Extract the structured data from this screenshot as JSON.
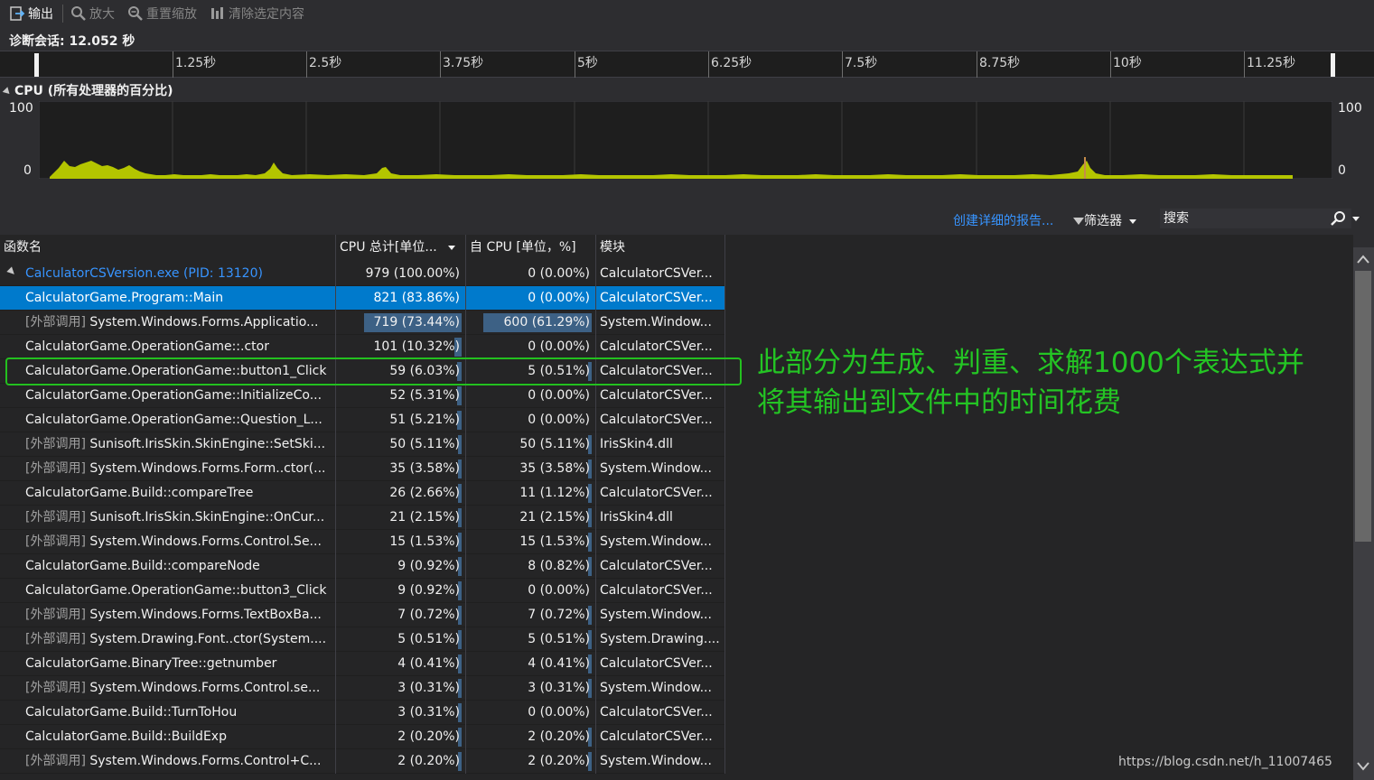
{
  "toolbar": {
    "output_label": "输出",
    "zoom_in_label": "放大",
    "reset_zoom_label": "重置缩放",
    "clear_selection_label": "清除选定内容"
  },
  "session": {
    "label": "诊断会话: 12.052 秒"
  },
  "ruler": {
    "ticks": [
      "1.25秒",
      "2.5秒",
      "3.75秒",
      "5秒",
      "6.25秒",
      "7.5秒",
      "8.75秒",
      "10秒",
      "11.25秒"
    ]
  },
  "cpu_chart": {
    "title": "CPU (所有处理器的百分比)",
    "y_max_left": "100",
    "y_min_left": "0",
    "y_max_right": "100",
    "y_min_right": "0",
    "fill_color": "#b4c500"
  },
  "report_link": "创建详细的报告...",
  "filter_label": "筛选器",
  "search": {
    "placeholder": "搜索"
  },
  "table": {
    "headers": {
      "name": "函数名",
      "total": "CPU 总计[单位...",
      "self": "自 CPU [单位，%]",
      "module": "模块"
    },
    "rows": [
      {
        "prefix": "",
        "name": "CalculatorCSVersion.exe (PID: 13120)",
        "total": "979 (100.00%)",
        "self": "0 (0.00%)",
        "module": "CalculatorCSVer...",
        "total_pct": 0,
        "self_pct": 0
      },
      {
        "prefix": "",
        "name": "CalculatorGame.Program::Main",
        "total": "821 (83.86%)",
        "self": "0 (0.00%)",
        "module": "CalculatorCSVer...",
        "total_pct": 0,
        "self_pct": 0
      },
      {
        "prefix": "[外部调用]",
        "name": " System.Windows.Forms.Applicatio...",
        "total": "719 (73.44%)",
        "self": "600 (61.29%)",
        "module": "System.Window...",
        "total_pct": 0.8,
        "self_pct": 0.89
      },
      {
        "prefix": "",
        "name": "CalculatorGame.OperationGame::.ctor",
        "total": "101 (10.32%)",
        "self": "0 (0.00%)",
        "module": "CalculatorCSVer...",
        "total_pct": 0.06,
        "self_pct": 0
      },
      {
        "prefix": "",
        "name": "CalculatorGame.OperationGame::button1_Click",
        "total": "59 (6.03%)",
        "self": "5 (0.51%)",
        "module": "CalculatorCSVer...",
        "total_pct": 0.04,
        "self_pct": 0.02
      },
      {
        "prefix": "",
        "name": "CalculatorGame.OperationGame::InitializeCo...",
        "total": "52 (5.31%)",
        "self": "0 (0.00%)",
        "module": "CalculatorCSVer...",
        "total_pct": 0.04,
        "self_pct": 0
      },
      {
        "prefix": "",
        "name": "CalculatorGame.OperationGame::Question_L...",
        "total": "51 (5.21%)",
        "self": "0 (0.00%)",
        "module": "CalculatorCSVer...",
        "total_pct": 0.04,
        "self_pct": 0
      },
      {
        "prefix": "[外部调用]",
        "name": " Sunisoft.IrisSkin.SkinEngine::SetSki...",
        "total": "50 (5.11%)",
        "self": "50 (5.11%)",
        "module": "IrisSkin4.dll",
        "total_pct": 0.03,
        "self_pct": 0.03
      },
      {
        "prefix": "[外部调用]",
        "name": " System.Windows.Forms.Form..ctor(...",
        "total": "35 (3.58%)",
        "self": "35 (3.58%)",
        "module": "System.Window...",
        "total_pct": 0.03,
        "self_pct": 0.03
      },
      {
        "prefix": "",
        "name": "CalculatorGame.Build::compareTree",
        "total": "26 (2.66%)",
        "self": "11 (1.12%)",
        "module": "CalculatorCSVer...",
        "total_pct": 0.02,
        "self_pct": 0.02
      },
      {
        "prefix": "[外部调用]",
        "name": " Sunisoft.IrisSkin.SkinEngine::OnCur...",
        "total": "21 (2.15%)",
        "self": "21 (2.15%)",
        "module": "IrisSkin4.dll",
        "total_pct": 0.02,
        "self_pct": 0.02
      },
      {
        "prefix": "[外部调用]",
        "name": " System.Windows.Forms.Control.Se...",
        "total": "15 (1.53%)",
        "self": "15 (1.53%)",
        "module": "System.Window...",
        "total_pct": 0.02,
        "self_pct": 0.02
      },
      {
        "prefix": "",
        "name": "CalculatorGame.Build::compareNode",
        "total": "9 (0.92%)",
        "self": "8 (0.82%)",
        "module": "CalculatorCSVer...",
        "total_pct": 0.02,
        "self_pct": 0.02
      },
      {
        "prefix": "",
        "name": "CalculatorGame.OperationGame::button3_Click",
        "total": "9 (0.92%)",
        "self": "0 (0.00%)",
        "module": "CalculatorCSVer...",
        "total_pct": 0.02,
        "self_pct": 0
      },
      {
        "prefix": "[外部调用]",
        "name": " System.Windows.Forms.TextBoxBa...",
        "total": "7 (0.72%)",
        "self": "7 (0.72%)",
        "module": "System.Window...",
        "total_pct": 0.02,
        "self_pct": 0.02
      },
      {
        "prefix": "[外部调用]",
        "name": " System.Drawing.Font..ctor(System....",
        "total": "5 (0.51%)",
        "self": "5 (0.51%)",
        "module": "System.Drawing....",
        "total_pct": 0.02,
        "self_pct": 0.02
      },
      {
        "prefix": "",
        "name": "CalculatorGame.BinaryTree::getnumber",
        "total": "4 (0.41%)",
        "self": "4 (0.41%)",
        "module": "CalculatorCSVer...",
        "total_pct": 0.02,
        "self_pct": 0.02
      },
      {
        "prefix": "[外部调用]",
        "name": " System.Windows.Forms.Control.se...",
        "total": "3 (0.31%)",
        "self": "3 (0.31%)",
        "module": "System.Window...",
        "total_pct": 0.02,
        "self_pct": 0.02
      },
      {
        "prefix": "",
        "name": "CalculatorGame.Build::TurnToHou",
        "total": "3 (0.31%)",
        "self": "0 (0.00%)",
        "module": "CalculatorCSVer...",
        "total_pct": 0.02,
        "self_pct": 0
      },
      {
        "prefix": "",
        "name": "CalculatorGame.Build::BuildExp",
        "total": "2 (0.20%)",
        "self": "2 (0.20%)",
        "module": "CalculatorCSVer...",
        "total_pct": 0.02,
        "self_pct": 0.02
      },
      {
        "prefix": "[外部调用]",
        "name": " System.Windows.Forms.Control+C...",
        "total": "2 (0.20%)",
        "self": "2 (0.20%)",
        "module": "System.Window...",
        "total_pct": 0.02,
        "self_pct": 0.02
      }
    ]
  },
  "annotation": {
    "line1": "此部分为生成、判重、求解1000个表达式并",
    "line2": "将其输出到文件中的时间花费"
  },
  "watermark": "https://blog.csdn.net/h_11007465"
}
